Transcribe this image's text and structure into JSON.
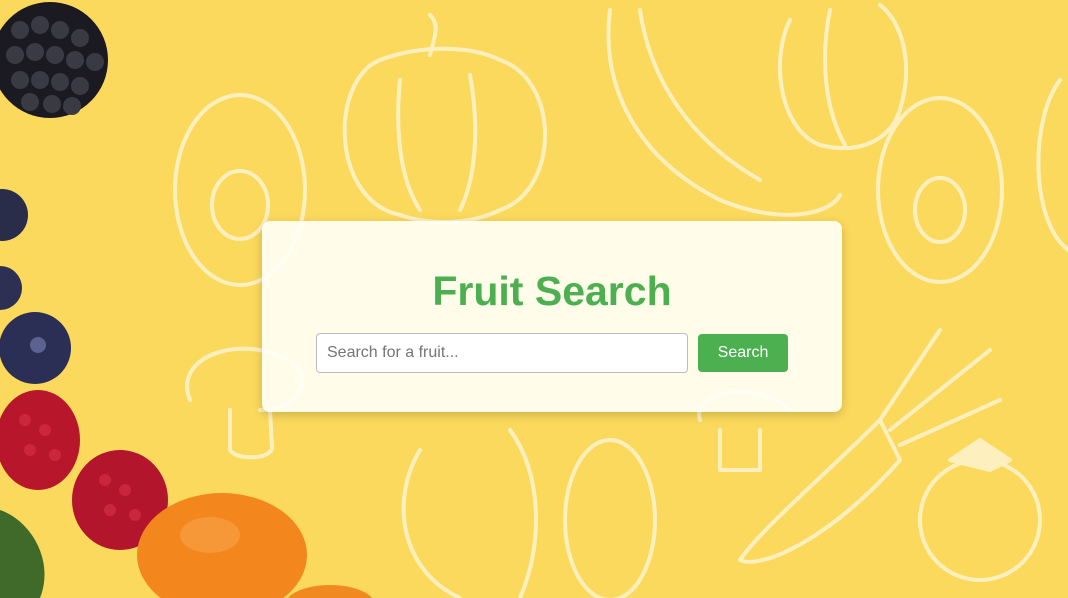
{
  "page": {
    "title": "Fruit Search"
  },
  "search": {
    "placeholder": "Search for a fruit...",
    "value": "",
    "button_label": "Search"
  },
  "colors": {
    "background": "#fbd95c",
    "accent": "#4caf50",
    "card": "#fffefa"
  },
  "background_image": {
    "description_icons": [
      "blackberry-icon",
      "blueberry-icon",
      "raspberry-icon",
      "orange-icon",
      "vegetable-doodles"
    ]
  }
}
